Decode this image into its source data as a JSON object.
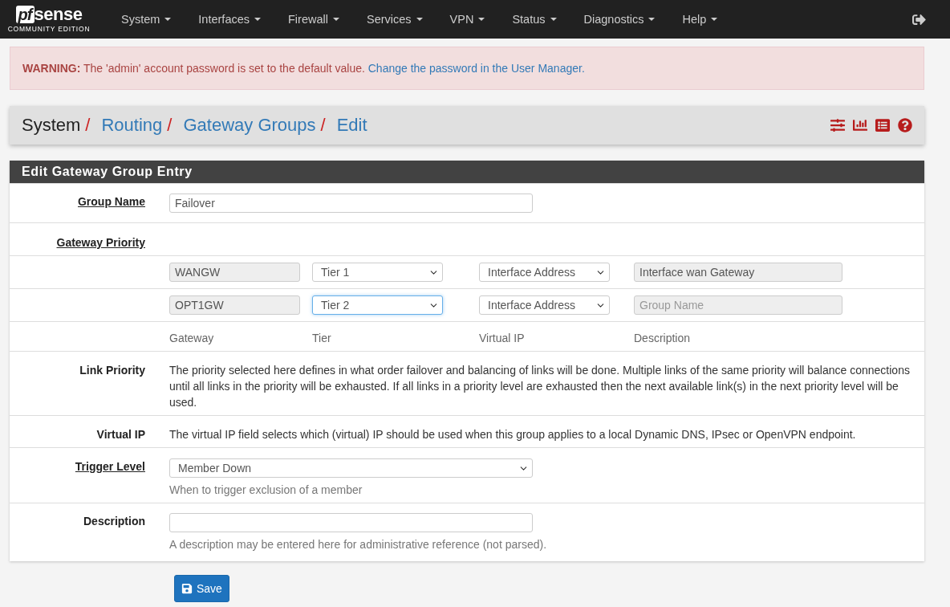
{
  "navbar": {
    "logo": {
      "mark": "pf",
      "word": "sense",
      "edition": "COMMUNITY EDITION"
    },
    "menus": [
      {
        "label": "System"
      },
      {
        "label": "Interfaces"
      },
      {
        "label": "Firewall"
      },
      {
        "label": "Services"
      },
      {
        "label": "VPN"
      },
      {
        "label": "Status"
      },
      {
        "label": "Diagnostics"
      },
      {
        "label": "Help"
      }
    ]
  },
  "warning": {
    "label": "WARNING:",
    "text": "The 'admin' account password is set to the default value.",
    "link": "Change the password in the User Manager."
  },
  "breadcrumb": [
    {
      "label": "System",
      "kind": "plain",
      "separator": "/"
    },
    {
      "label": "Routing",
      "kind": "link",
      "separator": "/"
    },
    {
      "label": "Gateway Groups",
      "kind": "link",
      "separator": "/"
    },
    {
      "label": "Edit",
      "kind": "link"
    }
  ],
  "panel": {
    "title": "Edit Gateway Group Entry",
    "rows": [
      {
        "kind": "input",
        "label": "Group Name",
        "help_link": true,
        "value": "Failover"
      },
      {
        "kind": "heading",
        "label": "Gateway Priority",
        "help_link": true
      },
      {
        "kind": "gateway",
        "gateway": "WANGW",
        "tier": "Tier 1",
        "tier_focused": false,
        "virtual_ip": "Interface Address",
        "description": "Interface wan Gateway"
      },
      {
        "kind": "gateway",
        "gateway": "OPT1GW",
        "tier": "Tier 2",
        "tier_focused": true,
        "virtual_ip": "Interface Address",
        "placeholder": "Group Name"
      },
      {
        "kind": "columns",
        "columns": [
          "Gateway",
          "Tier",
          "Virtual IP",
          "Description"
        ]
      },
      {
        "kind": "note",
        "label": "Link Priority",
        "help_link": false,
        "text": "The priority selected here defines in what order failover and balancing of links will be done. Multiple links of the same priority will balance connections until all links in the priority will be exhausted. If all links in a priority level are exhausted then the next available link(s) in the next priority level will be used."
      },
      {
        "kind": "note",
        "label": "Virtual IP",
        "help_link": false,
        "text": "The virtual IP field selects which (virtual) IP should be used when this group applies to a local Dynamic DNS, IPsec or OpenVPN endpoint."
      },
      {
        "kind": "select",
        "label": "Trigger Level",
        "help_link": true,
        "value": "Member Down",
        "help": "When to trigger exclusion of a member"
      },
      {
        "kind": "input",
        "label": "Description",
        "help_link": false,
        "help": "A description may be entered here for administrative reference (not parsed)."
      }
    ]
  },
  "save": {
    "label": "Save"
  }
}
